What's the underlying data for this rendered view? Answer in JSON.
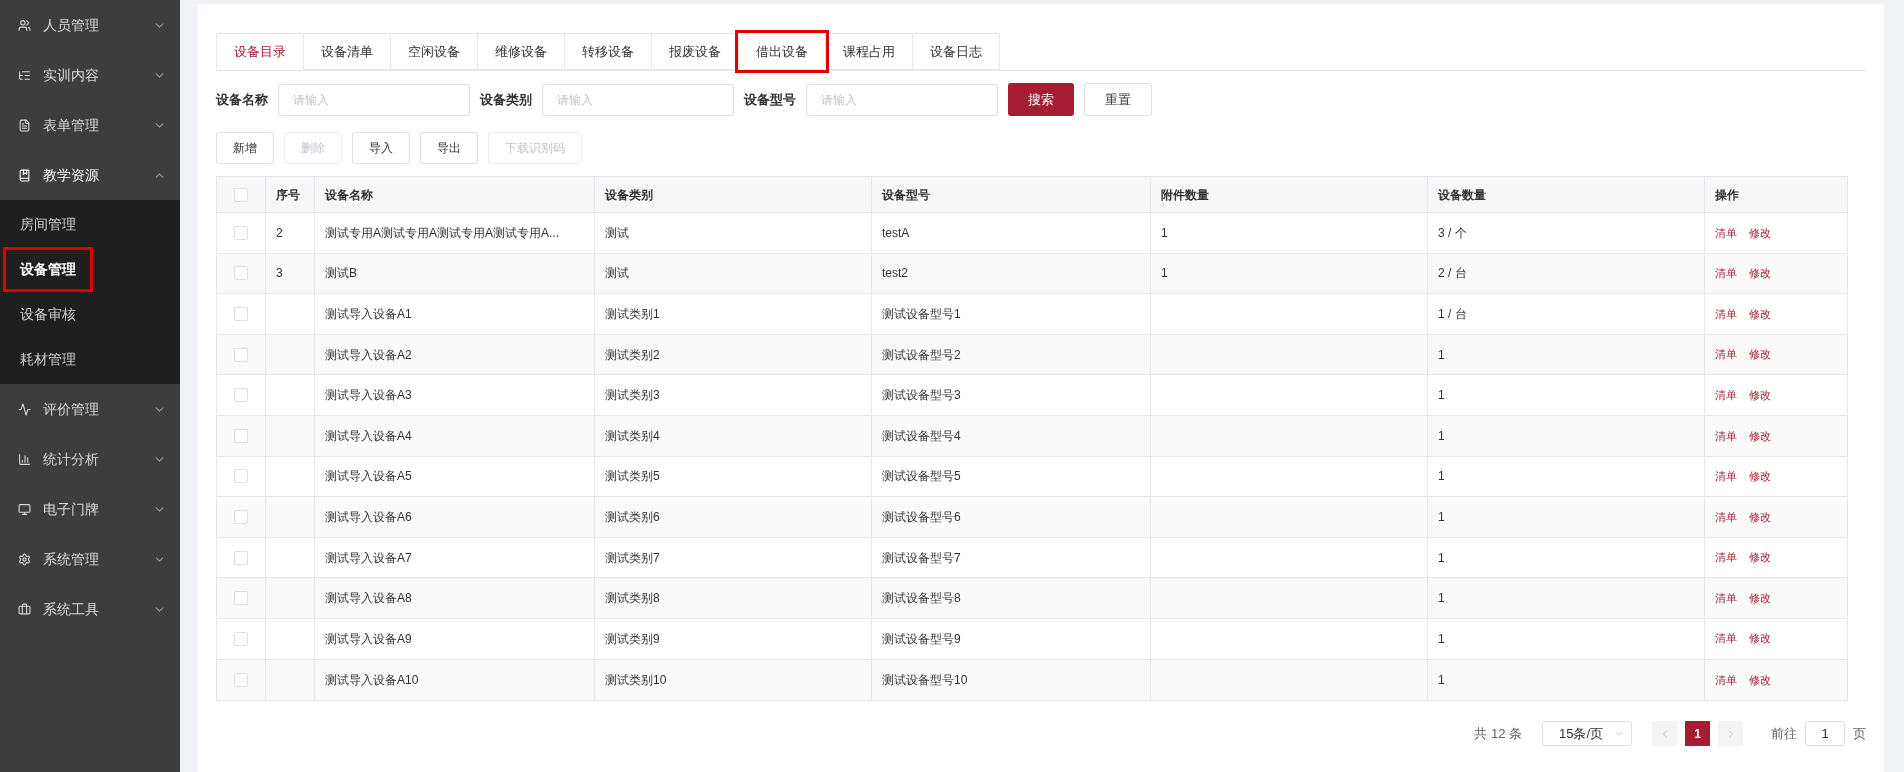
{
  "sidebar": {
    "items": [
      {
        "label": "人员管理",
        "expanded": false
      },
      {
        "label": "实训内容",
        "expanded": false
      },
      {
        "label": "表单管理",
        "expanded": false
      },
      {
        "label": "教学资源",
        "expanded": true,
        "children": [
          {
            "label": "房间管理",
            "selected": false,
            "highlighted": false
          },
          {
            "label": "设备管理",
            "selected": true,
            "highlighted": true
          },
          {
            "label": "设备审核",
            "selected": false,
            "highlighted": false
          },
          {
            "label": "耗材管理",
            "selected": false,
            "highlighted": false
          }
        ]
      },
      {
        "label": "评价管理",
        "expanded": false
      },
      {
        "label": "统计分析",
        "expanded": false
      },
      {
        "label": "电子门牌",
        "expanded": false
      },
      {
        "label": "系统管理",
        "expanded": false
      },
      {
        "label": "系统工具",
        "expanded": false
      }
    ]
  },
  "tabs": [
    {
      "label": "设备目录",
      "selected": true,
      "highlighted": false
    },
    {
      "label": "设备清单",
      "selected": false,
      "highlighted": false
    },
    {
      "label": "空闲设备",
      "selected": false,
      "highlighted": false
    },
    {
      "label": "维修设备",
      "selected": false,
      "highlighted": false
    },
    {
      "label": "转移设备",
      "selected": false,
      "highlighted": false
    },
    {
      "label": "报废设备",
      "selected": false,
      "highlighted": false
    },
    {
      "label": "借出设备",
      "selected": false,
      "highlighted": true
    },
    {
      "label": "课程占用",
      "selected": false,
      "highlighted": false
    },
    {
      "label": "设备日志",
      "selected": false,
      "highlighted": false
    }
  ],
  "filters": [
    {
      "label": "设备名称",
      "placeholder": "请输入"
    },
    {
      "label": "设备类别",
      "placeholder": "请输入"
    },
    {
      "label": "设备型号",
      "placeholder": "请输入"
    }
  ],
  "filter_buttons": [
    {
      "label": "搜索",
      "kind": "primary"
    },
    {
      "label": "重置",
      "kind": "default"
    }
  ],
  "toolbar": [
    {
      "label": "新增",
      "disabled": false
    },
    {
      "label": "删除",
      "disabled": true
    },
    {
      "label": "导入",
      "disabled": false
    },
    {
      "label": "导出",
      "disabled": false
    },
    {
      "label": "下载识别码",
      "disabled": true
    }
  ],
  "table": {
    "header_checked": false,
    "columns": [
      "序号",
      "设备名称",
      "设备类别",
      "设备型号",
      "附件数量",
      "设备数量",
      "操作"
    ],
    "rows": [
      {
        "checked": false,
        "cells": [
          "2",
          "测试专用A测试专用A测试专用A测试专用A...",
          "测试",
          "testA",
          "1",
          "3 / 个"
        ],
        "actions": [
          "清单",
          "修改"
        ]
      },
      {
        "checked": false,
        "cells": [
          "3",
          "测试B",
          "测试",
          "test2",
          "1",
          "2 / 台"
        ],
        "actions": [
          "清单",
          "修改"
        ]
      },
      {
        "checked": false,
        "cells": [
          "",
          "测试导入设备A1",
          "测试类别1",
          "测试设备型号1",
          "",
          "1 / 台"
        ],
        "actions": [
          "清单",
          "修改"
        ]
      },
      {
        "checked": false,
        "cells": [
          "",
          "测试导入设备A2",
          "测试类别2",
          "测试设备型号2",
          "",
          "1"
        ],
        "actions": [
          "清单",
          "修改"
        ]
      },
      {
        "checked": false,
        "cells": [
          "",
          "测试导入设备A3",
          "测试类别3",
          "测试设备型号3",
          "",
          "1"
        ],
        "actions": [
          "清单",
          "修改"
        ]
      },
      {
        "checked": false,
        "cells": [
          "",
          "测试导入设备A4",
          "测试类别4",
          "测试设备型号4",
          "",
          "1"
        ],
        "actions": [
          "清单",
          "修改"
        ]
      },
      {
        "checked": false,
        "cells": [
          "",
          "测试导入设备A5",
          "测试类别5",
          "测试设备型号5",
          "",
          "1"
        ],
        "actions": [
          "清单",
          "修改"
        ]
      },
      {
        "checked": false,
        "cells": [
          "",
          "测试导入设备A6",
          "测试类别6",
          "测试设备型号6",
          "",
          "1"
        ],
        "actions": [
          "清单",
          "修改"
        ]
      },
      {
        "checked": false,
        "cells": [
          "",
          "测试导入设备A7",
          "测试类别7",
          "测试设备型号7",
          "",
          "1"
        ],
        "actions": [
          "清单",
          "修改"
        ]
      },
      {
        "checked": false,
        "cells": [
          "",
          "测试导入设备A8",
          "测试类别8",
          "测试设备型号8",
          "",
          "1"
        ],
        "actions": [
          "清单",
          "修改"
        ]
      },
      {
        "checked": false,
        "cells": [
          "",
          "测试导入设备A9",
          "测试类别9",
          "测试设备型号9",
          "",
          "1"
        ],
        "actions": [
          "清单",
          "修改"
        ]
      },
      {
        "checked": false,
        "cells": [
          "",
          "测试导入设备A10",
          "测试类别10",
          "测试设备型号10",
          "",
          "1"
        ],
        "actions": [
          "清单",
          "修改"
        ]
      }
    ]
  },
  "pagination": {
    "total": "共 12 条",
    "page_size": "15条/页",
    "prev_disabled": true,
    "next_disabled": true,
    "pages": [
      {
        "label": "1",
        "selected": true
      }
    ],
    "goto_label": "前往",
    "goto_value": "1",
    "goto_suffix": "页"
  }
}
